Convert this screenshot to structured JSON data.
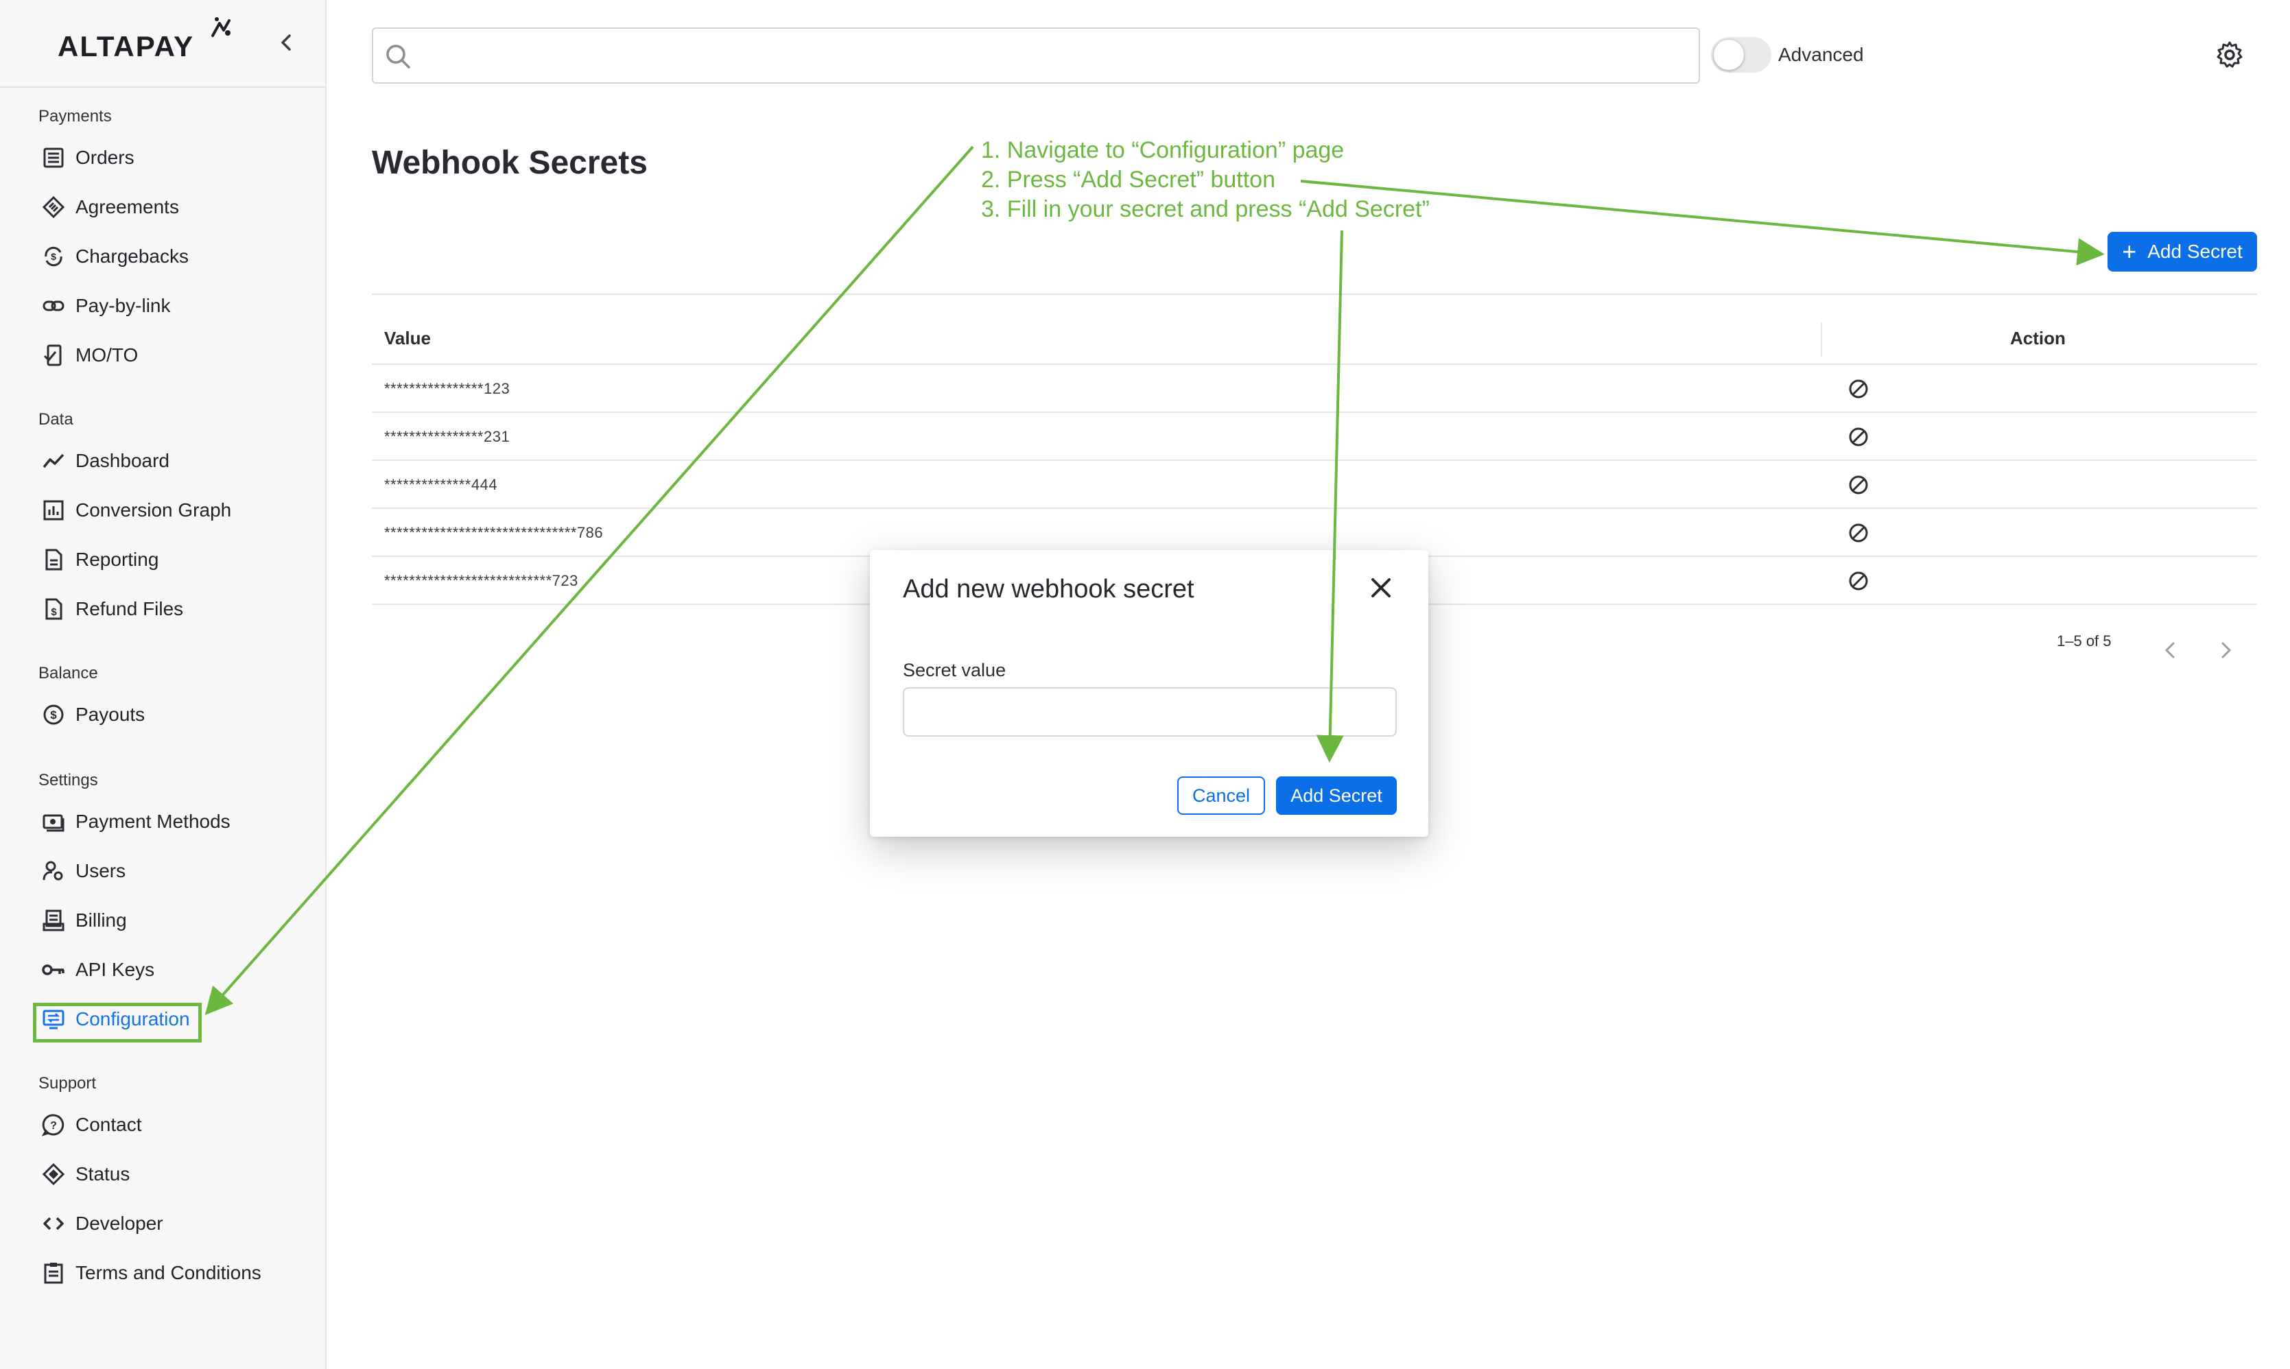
{
  "brand": {
    "name": "ALTAPAY"
  },
  "sidebar": {
    "sections": [
      {
        "label": "Payments",
        "items": [
          {
            "label": "Orders",
            "icon": "orders-icon"
          },
          {
            "label": "Agreements",
            "icon": "agreements-icon"
          },
          {
            "label": "Chargebacks",
            "icon": "chargebacks-icon"
          },
          {
            "label": "Pay-by-link",
            "icon": "link-icon"
          },
          {
            "label": "MO/TO",
            "icon": "moto-icon"
          }
        ]
      },
      {
        "label": "Data",
        "items": [
          {
            "label": "Dashboard",
            "icon": "dashboard-icon"
          },
          {
            "label": "Conversion Graph",
            "icon": "graph-icon"
          },
          {
            "label": "Reporting",
            "icon": "reporting-icon"
          },
          {
            "label": "Refund Files",
            "icon": "refund-files-icon"
          }
        ]
      },
      {
        "label": "Balance",
        "items": [
          {
            "label": "Payouts",
            "icon": "payouts-icon"
          }
        ]
      },
      {
        "label": "Settings",
        "items": [
          {
            "label": "Payment Methods",
            "icon": "payment-methods-icon"
          },
          {
            "label": "Users",
            "icon": "users-icon"
          },
          {
            "label": "Billing",
            "icon": "billing-icon"
          },
          {
            "label": "API Keys",
            "icon": "key-icon"
          },
          {
            "label": "Configuration",
            "icon": "configuration-icon",
            "active": true
          }
        ]
      },
      {
        "label": "Support",
        "items": [
          {
            "label": "Contact",
            "icon": "contact-icon"
          },
          {
            "label": "Status",
            "icon": "status-icon"
          },
          {
            "label": "Developer",
            "icon": "code-icon"
          },
          {
            "label": "Terms and Conditions",
            "icon": "terms-icon"
          }
        ]
      }
    ]
  },
  "topbar": {
    "search_value": "",
    "advanced_label": "Advanced",
    "advanced_on": false
  },
  "main": {
    "title": "Webhook Secrets",
    "add_button_label": "Add Secret",
    "table": {
      "columns": [
        "Value",
        "Action"
      ],
      "rows": [
        {
          "value": "****************123"
        },
        {
          "value": "****************231"
        },
        {
          "value": "**************444"
        },
        {
          "value": "*******************************786"
        },
        {
          "value": "***************************723"
        }
      ]
    },
    "pagination": {
      "text": "1–5 of 5"
    }
  },
  "modal": {
    "title": "Add new webhook secret",
    "field_label": "Secret value",
    "field_value": "",
    "cancel_label": "Cancel",
    "submit_label": "Add Secret"
  },
  "annotation": {
    "color": "#6cb73f",
    "steps": [
      "1. Navigate to “Configuration” page",
      "2. Press “Add Secret” button",
      "3. Fill in your secret and press “Add Secret”"
    ]
  },
  "colors": {
    "accent": "#0b6fe8",
    "annotation": "#6cb73f",
    "sidebar_bg": "#f7f7f8"
  }
}
